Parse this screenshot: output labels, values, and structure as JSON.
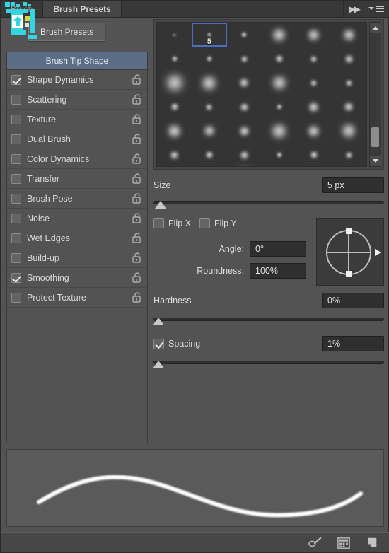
{
  "window": {
    "tabs": [
      {
        "label": "Brush",
        "active": false
      },
      {
        "label": "Brush Presets",
        "active": true
      }
    ],
    "collapse_icon": "double-chevron-right-icon",
    "menu_icon": "panel-menu-icon"
  },
  "toolbar": {
    "presets_button": "Brush Presets"
  },
  "options": {
    "header": "Brush Tip Shape",
    "items": [
      {
        "label": "Shape Dynamics",
        "checked": true,
        "lock": "unlock-icon"
      },
      {
        "label": "Scattering",
        "checked": false,
        "lock": "unlock-icon"
      },
      {
        "label": "Texture",
        "checked": false,
        "lock": "unlock-icon"
      },
      {
        "label": "Dual Brush",
        "checked": false,
        "lock": "unlock-icon"
      },
      {
        "label": "Color Dynamics",
        "checked": false,
        "lock": "unlock-icon"
      },
      {
        "label": "Transfer",
        "checked": false,
        "lock": "unlock-icon"
      },
      {
        "label": "Brush Pose",
        "checked": false,
        "lock": "unlock-icon"
      },
      {
        "label": "Noise",
        "checked": false,
        "lock": "unlock-icon"
      },
      {
        "label": "Wet Edges",
        "checked": false,
        "lock": "unlock-icon"
      },
      {
        "label": "Build-up",
        "checked": false,
        "lock": "unlock-icon"
      },
      {
        "label": "Smoothing",
        "checked": true,
        "lock": "unlock-icon"
      },
      {
        "label": "Protect Texture",
        "checked": false,
        "lock": "unlock-icon"
      }
    ]
  },
  "brush_grid": {
    "selected_label": "5",
    "scrollbar": {
      "up_icon": "scroll-up-arrow-icon",
      "down_icon": "scroll-down-arrow-icon"
    },
    "tips": [
      {
        "size": 3,
        "label": "",
        "selected": false
      },
      {
        "size": 4,
        "label": "5",
        "selected": true
      },
      {
        "size": 6,
        "label": "",
        "selected": false
      },
      {
        "size": 15,
        "label": "",
        "selected": false
      },
      {
        "size": 13,
        "label": "",
        "selected": false
      },
      {
        "size": 13,
        "label": "",
        "selected": false
      },
      {
        "size": 6,
        "label": "",
        "selected": false
      },
      {
        "size": 6,
        "label": "",
        "selected": false
      },
      {
        "size": 7,
        "label": "",
        "selected": false
      },
      {
        "size": 8,
        "label": "",
        "selected": false
      },
      {
        "size": 7,
        "label": "",
        "selected": false
      },
      {
        "size": 9,
        "label": "",
        "selected": false
      },
      {
        "size": 20,
        "label": "",
        "selected": false
      },
      {
        "size": 17,
        "label": "",
        "selected": false
      },
      {
        "size": 10,
        "label": "",
        "selected": false
      },
      {
        "size": 16,
        "label": "",
        "selected": false
      },
      {
        "size": 7,
        "label": "",
        "selected": false
      },
      {
        "size": 7,
        "label": "",
        "selected": false
      },
      {
        "size": 8,
        "label": "",
        "selected": false
      },
      {
        "size": 7,
        "label": "",
        "selected": false
      },
      {
        "size": 9,
        "label": "",
        "selected": false
      },
      {
        "size": 6,
        "label": "",
        "selected": false
      },
      {
        "size": 11,
        "label": "",
        "selected": false
      },
      {
        "size": 10,
        "label": "",
        "selected": false
      },
      {
        "size": 15,
        "label": "",
        "selected": false
      },
      {
        "size": 12,
        "label": "",
        "selected": false
      },
      {
        "size": 11,
        "label": "",
        "selected": false
      },
      {
        "size": 17,
        "label": "",
        "selected": false
      },
      {
        "size": 13,
        "label": "",
        "selected": false
      },
      {
        "size": 16,
        "label": "",
        "selected": false
      },
      {
        "size": 9,
        "label": "",
        "selected": false
      },
      {
        "size": 8,
        "label": "",
        "selected": false
      },
      {
        "size": 9,
        "label": "",
        "selected": false
      },
      {
        "size": 6,
        "label": "",
        "selected": false
      },
      {
        "size": 8,
        "label": "",
        "selected": false
      },
      {
        "size": 7,
        "label": "",
        "selected": false
      },
      {
        "size": 16,
        "label": "",
        "selected": false
      },
      {
        "size": 14,
        "label": "",
        "selected": false
      },
      {
        "size": 22,
        "label": "",
        "selected": false
      },
      {
        "size": 9,
        "label": "",
        "selected": false
      },
      {
        "size": 14,
        "label": "",
        "selected": false
      },
      {
        "size": 13,
        "label": "",
        "selected": false
      },
      {
        "size": 7,
        "label": "",
        "selected": false
      },
      {
        "size": 7,
        "label": "",
        "selected": false
      },
      {
        "size": 9,
        "label": "",
        "selected": false
      },
      {
        "size": 12,
        "label": "",
        "selected": false
      },
      {
        "size": 7,
        "label": "",
        "selected": false
      },
      {
        "size": 8,
        "label": "",
        "selected": false
      },
      {
        "size": 9,
        "label": "",
        "selected": false
      },
      {
        "size": 8,
        "label": "",
        "selected": false
      },
      {
        "size": 13,
        "label": "",
        "selected": false
      },
      {
        "size": 19,
        "label": "",
        "selected": false
      },
      {
        "size": 14,
        "label": "",
        "selected": false
      },
      {
        "size": 15,
        "label": "",
        "selected": false
      }
    ]
  },
  "controls": {
    "size": {
      "label": "Size",
      "value": "5 px",
      "slider_pct": 1
    },
    "flip_x": {
      "label": "Flip X",
      "checked": false
    },
    "flip_y": {
      "label": "Flip Y",
      "checked": false
    },
    "angle": {
      "label": "Angle:",
      "value": "0°"
    },
    "roundness": {
      "label": "Roundness:",
      "value": "100%"
    },
    "hardness": {
      "label": "Hardness",
      "value": "0%",
      "slider_pct": 0
    },
    "spacing": {
      "label": "Spacing",
      "checked": true,
      "value": "1%",
      "slider_pct": 0
    },
    "angle_control_icon": "angle-roundness-dial-icon"
  },
  "preview": {
    "stroke_name": "brush-stroke-preview"
  },
  "footer": {
    "icons": [
      {
        "name": "toggle-brush-panel-icon"
      },
      {
        "name": "brush-grid-view-icon"
      },
      {
        "name": "new-brush-preset-icon"
      }
    ]
  },
  "colors": {
    "panel_bg": "#535353",
    "header_blue": "#5b6d84",
    "selection_blue": "#4a6fc0",
    "field_bg": "#2f2f2f"
  }
}
